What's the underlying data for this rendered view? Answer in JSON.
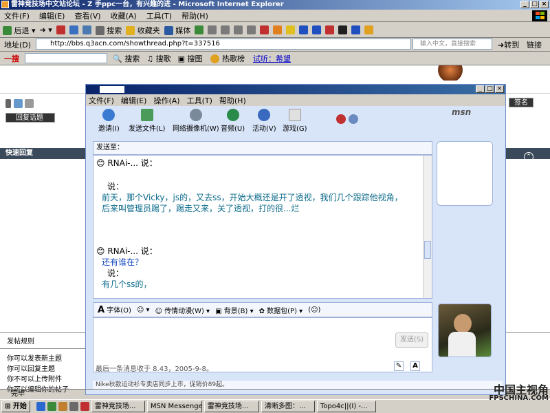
{
  "ie": {
    "title": "雷神竞技场中文站论坛 - Z 手ppc一台，有兴趣的进 - Microsoft Internet Explorer",
    "menus": [
      "文件(F)",
      "编辑(E)",
      "查看(V)",
      "收藏(A)",
      "工具(T)",
      "帮助(H)"
    ],
    "toolbar": {
      "back": "后退",
      "search": "搜索",
      "favorites": "收藏夹",
      "media": "媒体"
    },
    "address_label": "地址(D)",
    "address_value": "http://bbs.q3acn.com/showthread.php?t=337516",
    "search_placeholder": "输入中文，直接搜索",
    "go_label": "转到",
    "links_label": "链接",
    "google": {
      "brand": "一搜",
      "search": "搜索",
      "music": "搜歌",
      "image": "搜图",
      "hot": "热歌榜",
      "try": "试听：希望"
    },
    "status": "完毕"
  },
  "forum": {
    "quick_reply": "快速回复",
    "reply_topic": "回复话题",
    "sign": "签名",
    "rules_title": "发帖规则",
    "rules": [
      "你可以发表新主题",
      "你可以回复主题",
      "你不可以上传附件",
      "你可以编辑你的帖子"
    ]
  },
  "msn": {
    "menus": [
      "文件(F)",
      "编辑(E)",
      "操作(A)",
      "工具(T)",
      "帮助(H)"
    ],
    "tools": [
      "邀请(I)",
      "发送文件(L)",
      "网络摄像机(W)",
      "音频(U)",
      "活动(V)",
      "游戏(G)"
    ],
    "sendto_label": "发送至：",
    "messages": [
      {
        "sender": "RNAi-... 说：",
        "lines": [
          "说：",
          "前天，那个Vicky，js的，又去ss，开始大概还是开了透视，我们几个跟踪他视角，",
          "后来叫管理员踢了，踢走又来，关了透视，打的很...烂"
        ]
      },
      {
        "sender": "RNAi-... 说：",
        "lines": [
          "还有谁在？",
          "说：",
          "有几个ss的，"
        ]
      }
    ],
    "format": {
      "font": "字体(O)",
      "wink": "传情动漫(W)",
      "background": "背景(B)",
      "pack": "数据包(P)"
    },
    "send_label": "发送(S)",
    "last_message": "最后一条消息收于 8.43，2005-9-8。",
    "footer": "Nike秋款运动衫专卖店同步上市，促销价89起。"
  },
  "taskbar": {
    "start": "开始",
    "items": [
      "雷神竞技场...",
      "MSN Messenger",
      "雷神竞技场...",
      "清晰多图：...",
      "Topo4c||(I) -..."
    ]
  },
  "watermark": {
    "line1": "中国主视角",
    "line2": "FPSCHINA.COM"
  }
}
